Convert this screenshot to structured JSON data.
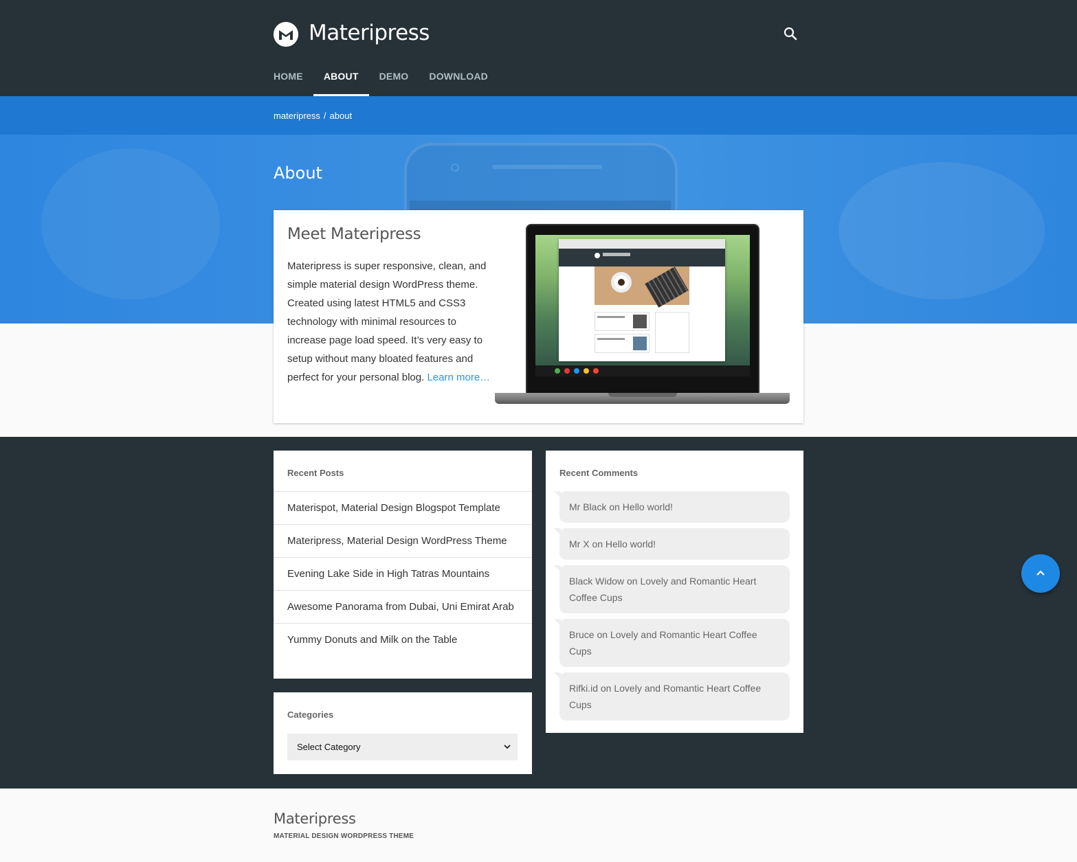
{
  "site": {
    "title": "Materipress",
    "logo_icon": "materipress-m-logo-icon",
    "search_icon": "search-icon"
  },
  "nav": {
    "items": [
      {
        "label": "HOME",
        "active": false
      },
      {
        "label": "ABOUT",
        "active": true
      },
      {
        "label": "DEMO",
        "active": false
      },
      {
        "label": "DOWNLOAD",
        "active": false
      }
    ]
  },
  "breadcrumb": {
    "root": "materipress",
    "separator": "/",
    "current": "about"
  },
  "page": {
    "title": "About"
  },
  "about_card": {
    "heading": "Meet Materipress",
    "body": "Materipress is super responsive, clean, and simple material design WordPress theme. Created using latest HTML5 and CSS3 technology with minimal resources to increase page load speed. It’s very easy to setup without many bloated features and perfect for your personal blog.",
    "link_label": "Learn more…"
  },
  "recent_posts": {
    "title": "Recent Posts",
    "items": [
      "Materispot, Material Design Blogspot Template",
      "Materipress, Material Design WordPress Theme",
      "Evening Lake Side in High Tatras Mountains",
      "Awesome Panorama from Dubai, Uni Emirat Arab",
      "Yummy Donuts and Milk on the Table"
    ]
  },
  "categories": {
    "title": "Categories",
    "selected": "Select Category"
  },
  "recent_comments": {
    "title": "Recent Comments",
    "items": [
      "Mr Black on Hello world!",
      "Mr X on Hello world!",
      "Black Widow on Lovely and Romantic Heart Coffee Cups",
      "Bruce on Lovely and Romantic Heart Coffee Cups",
      "Rifki.id on Lovely and Romantic Heart Coffee Cups"
    ]
  },
  "footer": {
    "title": "Materipress",
    "tagline": "MATERIAL DESIGN WORDPRESS THEME"
  },
  "fab": {
    "icon": "chevron-up-icon"
  },
  "colors": {
    "header_bg": "#263238",
    "accent_blue": "#1f78d1",
    "link": "#2196f3",
    "fab": "#1e88e5"
  }
}
